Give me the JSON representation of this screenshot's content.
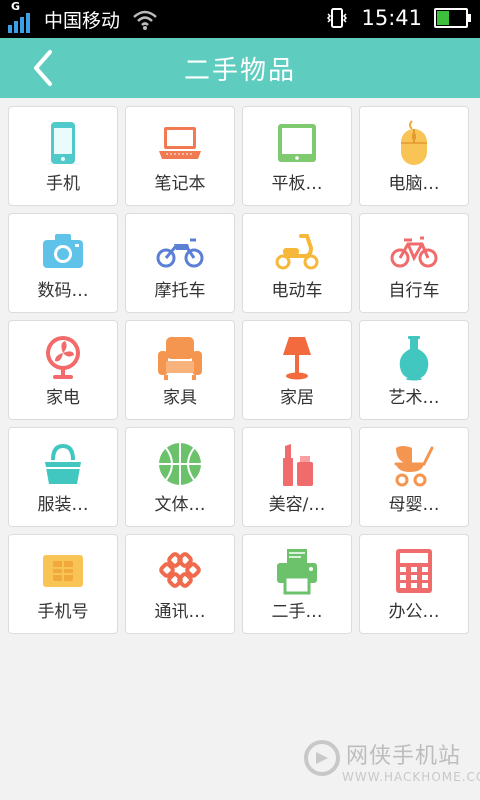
{
  "status_bar": {
    "network_type": "G",
    "carrier": "中国移动",
    "time": "15:41",
    "battery_level": 0.4,
    "signal_color": "#3aa0e8",
    "battery_color": "#3dc13d"
  },
  "header": {
    "title": "二手物品",
    "bg_color": "#5fccc0"
  },
  "categories": [
    {
      "label": "手机",
      "icon": "phone-icon"
    },
    {
      "label": "笔记本",
      "icon": "laptop-icon"
    },
    {
      "label": "平板…",
      "icon": "tablet-icon"
    },
    {
      "label": "电脑…",
      "icon": "mouse-icon"
    },
    {
      "label": "数码…",
      "icon": "camera-icon"
    },
    {
      "label": "摩托车",
      "icon": "motorcycle-icon"
    },
    {
      "label": "电动车",
      "icon": "scooter-icon"
    },
    {
      "label": "自行车",
      "icon": "bicycle-icon"
    },
    {
      "label": "家电",
      "icon": "fan-icon"
    },
    {
      "label": "家具",
      "icon": "armchair-icon"
    },
    {
      "label": "家居",
      "icon": "lamp-icon"
    },
    {
      "label": "艺术…",
      "icon": "vase-icon"
    },
    {
      "label": "服装…",
      "icon": "handbag-icon"
    },
    {
      "label": "文体…",
      "icon": "basketball-icon"
    },
    {
      "label": "美容/…",
      "icon": "cosmetics-icon"
    },
    {
      "label": "母婴…",
      "icon": "stroller-icon"
    },
    {
      "label": "手机号",
      "icon": "sim-card-icon"
    },
    {
      "label": "通讯…",
      "icon": "unicom-knot-icon"
    },
    {
      "label": "二手…",
      "icon": "printer-icon"
    },
    {
      "label": "办公…",
      "icon": "calculator-icon"
    }
  ],
  "watermark": {
    "text": "网侠手机站",
    "url": "WWW.HACKHOME.COM"
  }
}
